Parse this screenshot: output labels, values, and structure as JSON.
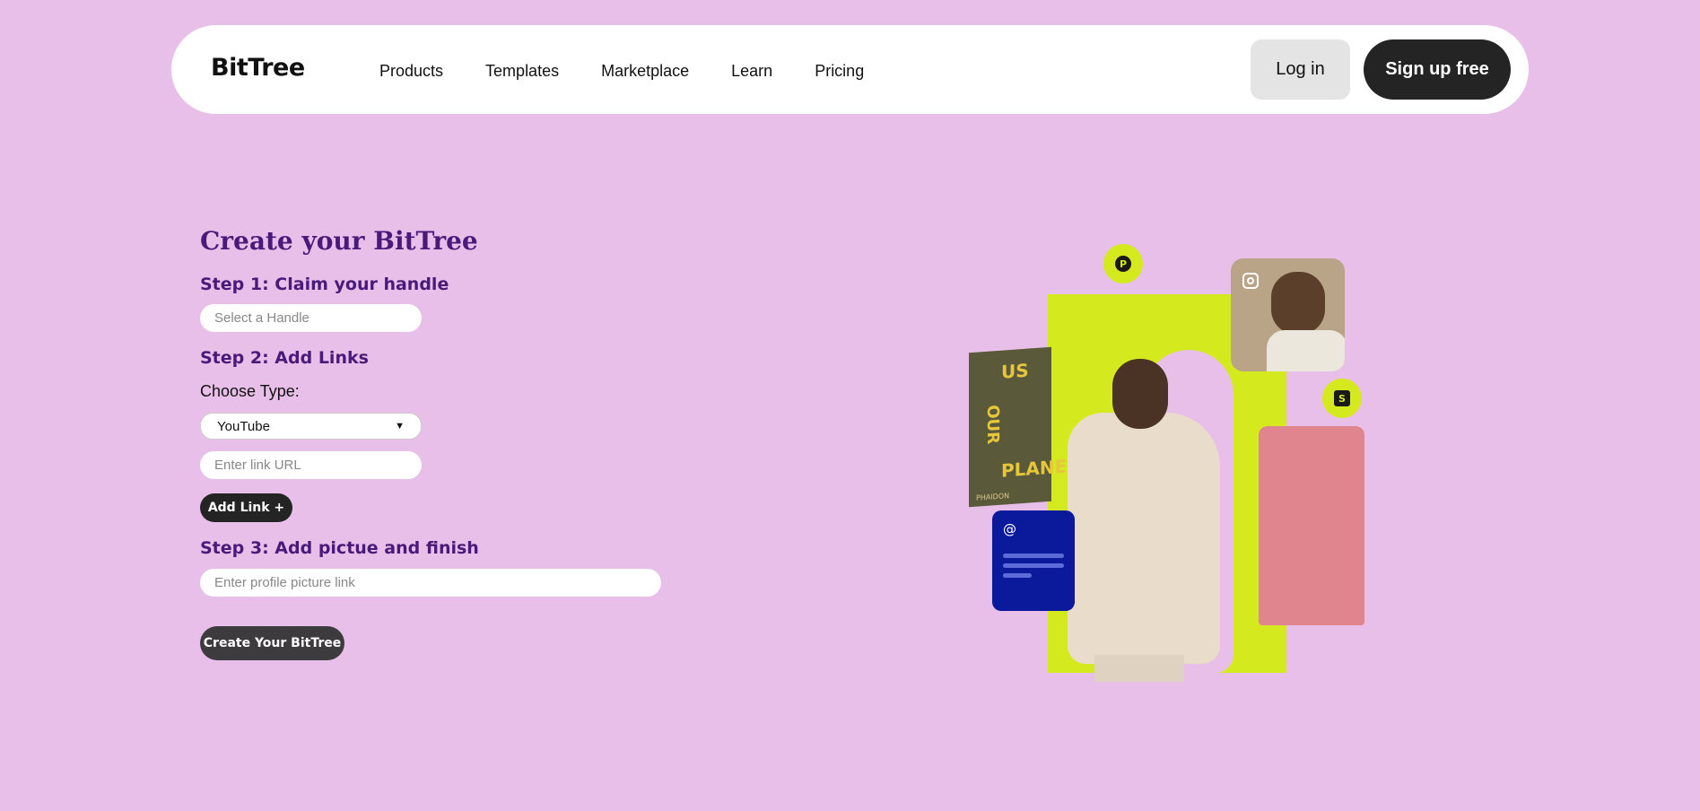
{
  "nav": {
    "logo": "BitTree",
    "links": [
      "Products",
      "Templates",
      "Marketplace",
      "Learn",
      "Pricing"
    ],
    "login_label": "Log in",
    "signup_label": "Sign up free"
  },
  "form": {
    "title": "Create your BitTree",
    "step1": {
      "heading": "Step 1: Claim your handle",
      "handle_placeholder": "Select a Handle"
    },
    "step2": {
      "heading": "Step 2: Add Links",
      "type_label": "Choose Type:",
      "type_selected": "YouTube",
      "url_placeholder": "Enter link URL",
      "add_button": "Add Link +"
    },
    "step3": {
      "heading": "Step 3: Add pictue and finish",
      "picture_placeholder": "Enter profile picture link"
    },
    "create_button": "Create Your BitTree"
  },
  "illustration": {
    "book_lines": [
      "US",
      "OUR",
      "PLANE"
    ],
    "book_publisher": "PHAIDON"
  },
  "colors": {
    "background": "#e8bfe8",
    "accent_green": "#d4ea1e",
    "heading_purple": "#4a1a7a",
    "dark_button": "#242424"
  }
}
